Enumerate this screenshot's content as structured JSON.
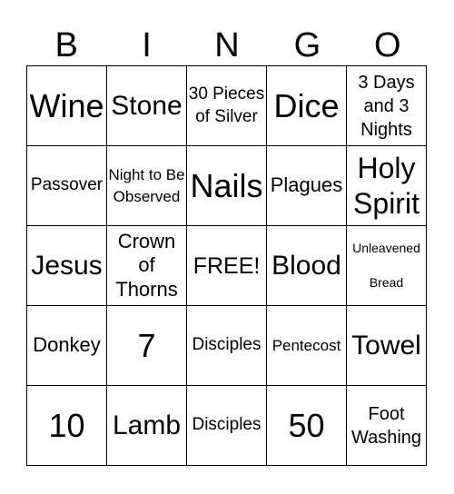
{
  "header": [
    "B",
    "I",
    "N",
    "G",
    "O"
  ],
  "rows": [
    [
      "Wine",
      "Stone",
      "30 Pieces of Silver",
      "Dice",
      "3 Days and 3 Nights"
    ],
    [
      "Passover",
      "Night to Be Observed",
      "Nails",
      "Plagues",
      "Holy Spirit"
    ],
    [
      "Jesus",
      "Crown of Thorns",
      "FREE!",
      "Blood",
      "Unleavened Bread"
    ],
    [
      "Donkey",
      "7",
      "Disciples",
      "Pentecost",
      "Towel"
    ],
    [
      "10",
      "Lamb",
      "Disciples",
      "50",
      "Foot Washing"
    ]
  ]
}
